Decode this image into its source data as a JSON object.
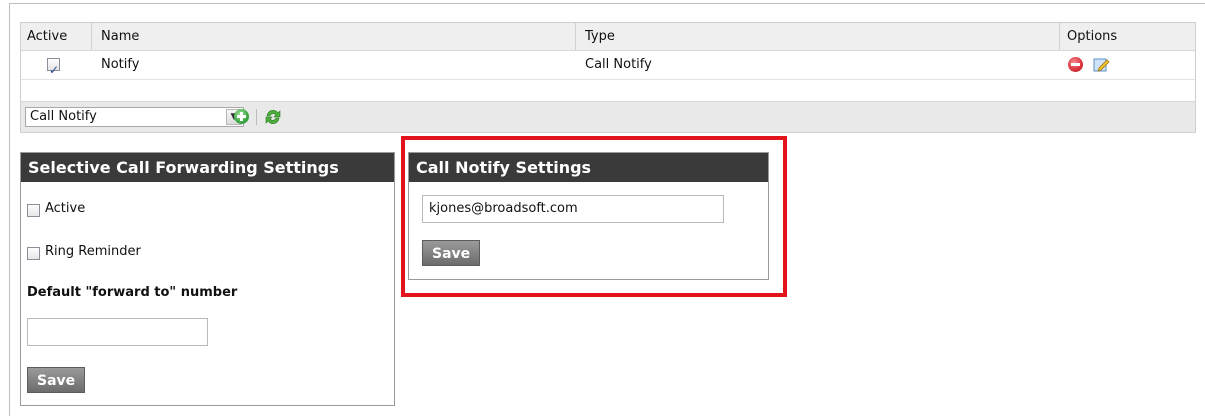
{
  "grid": {
    "columns": {
      "active": "Active",
      "name": "Name",
      "type": "Type",
      "options": "Options"
    },
    "rows": [
      {
        "active": true,
        "name": "Notify",
        "type": "Call Notify"
      }
    ]
  },
  "toolbar": {
    "selected_service": "Call Notify"
  },
  "selective_forwarding": {
    "title": "Selective Call Forwarding Settings",
    "active_label": "Active",
    "active_checked": false,
    "ring_reminder_label": "Ring Reminder",
    "ring_reminder_checked": false,
    "forward_to_label": "Default \"forward to\" number",
    "forward_to_value": "",
    "save_label": "Save"
  },
  "call_notify": {
    "title": "Call Notify Settings",
    "email_value": "kjones@broadsoft.com",
    "save_label": "Save"
  },
  "colors": {
    "highlight": "#e3131b",
    "panel_header": "#3a3a3a",
    "add_green": "#3aa843",
    "delete_red": "#d9313a"
  },
  "icons": [
    "checkbox-checked-icon",
    "delete-icon",
    "edit-icon",
    "dropdown-arrow-icon",
    "add-icon",
    "refresh-icon"
  ]
}
